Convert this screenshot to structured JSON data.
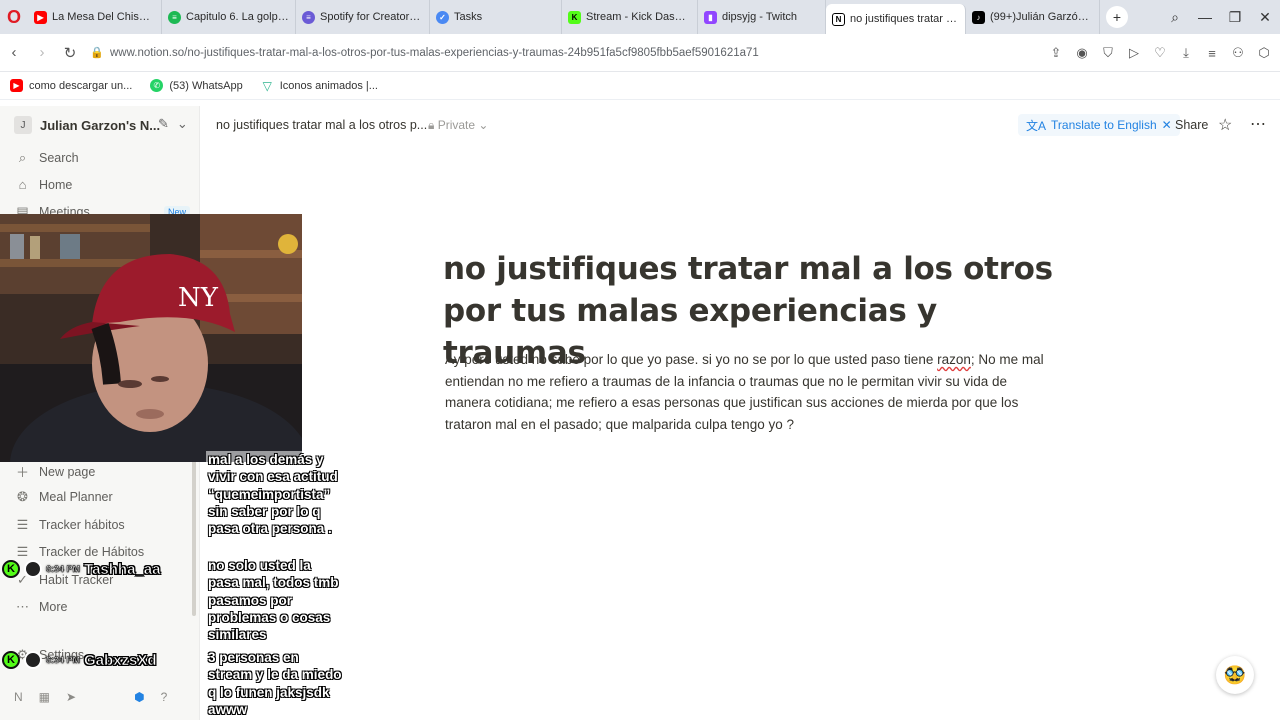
{
  "browser": {
    "tabs": [
      {
        "title": "La Mesa Del Chisme - Yo",
        "icon": "youtube-icon",
        "color": "#ff0000"
      },
      {
        "title": "Capitulo 6. La golpeó ha",
        "icon": "spotify-icon",
        "color": "#1db954"
      },
      {
        "title": "Spotify for Creators: la fo",
        "icon": "spotify-creators-icon",
        "color": "#6b5bd6"
      },
      {
        "title": "Tasks",
        "icon": "tasks-icon",
        "color": "#4a89f3"
      },
      {
        "title": "Stream - Kick Dashboard",
        "icon": "kick-icon",
        "color": "#53fc18"
      },
      {
        "title": "dipsyjg - Twitch",
        "icon": "twitch-icon",
        "color": "#9146ff"
      },
      {
        "title": "no justifiques tratar mal a",
        "icon": "notion-icon",
        "color": "#000000"
      },
      {
        "title": "(99+)Julián Garzón (@di",
        "icon": "tiktok-icon",
        "color": "#000000"
      }
    ],
    "url": "www.notion.so/no-justifiques-tratar-mal-a-los-otros-por-tus-malas-experiencias-y-traumas-24b951fa5cf9805fbb5aef5901621a71",
    "bookmarks": [
      {
        "label": "como descargar un...",
        "icon": "youtube-icon"
      },
      {
        "label": "(53) WhatsApp",
        "icon": "whatsapp-icon"
      },
      {
        "label": "Iconos animados |...",
        "icon": "vector-icon"
      }
    ]
  },
  "notion": {
    "workspace": {
      "initial": "J",
      "name": "Julian Garzon's N..."
    },
    "sidebar": {
      "top_items": [
        {
          "label": "Search",
          "icon": "search-icon"
        },
        {
          "label": "Home",
          "icon": "home-icon"
        },
        {
          "label": "Meetings",
          "icon": "meetings-icon",
          "badge": "New"
        }
      ],
      "items": [
        {
          "label": "New page",
          "icon": "plus-icon"
        },
        {
          "label": "Meal Planner",
          "icon": "meal-icon"
        },
        {
          "label": "Tracker hábitos",
          "icon": "checklist-icon"
        },
        {
          "label": "Tracker de Hábitos",
          "icon": "checklist-icon"
        },
        {
          "label": "Habit Tracker",
          "icon": "check-icon"
        },
        {
          "label": "More",
          "icon": "ellipsis-icon"
        },
        {
          "label": "Settings",
          "icon": "gear-icon"
        }
      ]
    },
    "topbar": {
      "breadcrumb": "no justifiques tratar mal a los otros p...",
      "privacy": "Private",
      "translate": "Translate to English",
      "share": "Share"
    },
    "page": {
      "title": "no justifiques tratar mal a los otros por tus malas experiencias y traumas",
      "body_before": "Ay pero usted no sabe por lo que yo pase. si yo no se por lo que usted paso tiene ",
      "body_flagged": "razon",
      "body_after": "; No me mal entiendan no me refiero a traumas de la infancia o traumas que no le permitan vivir su vida de manera cotidiana; me refiero a esas personas que justifican sus acciones de mierda por que los trataron mal en el pasado; que malparida culpa tengo yo ?"
    }
  },
  "chat": [
    {
      "user": "",
      "time": "",
      "message": "mal a los demás y vivir con esa actitud “quemeimportista” sin saber por lo q pasa otra persona ."
    },
    {
      "user": "Tashha_aa",
      "time": "6:34 PM",
      "message": "no solo usted la pasa mal, todos tmb pasamos por problemas o cosas similares"
    },
    {
      "user": "GabxzsXd",
      "time": "6:34 PM",
      "message": "3 personas en stream y le da miedo q lo funen jaksjsdk awww"
    }
  ]
}
